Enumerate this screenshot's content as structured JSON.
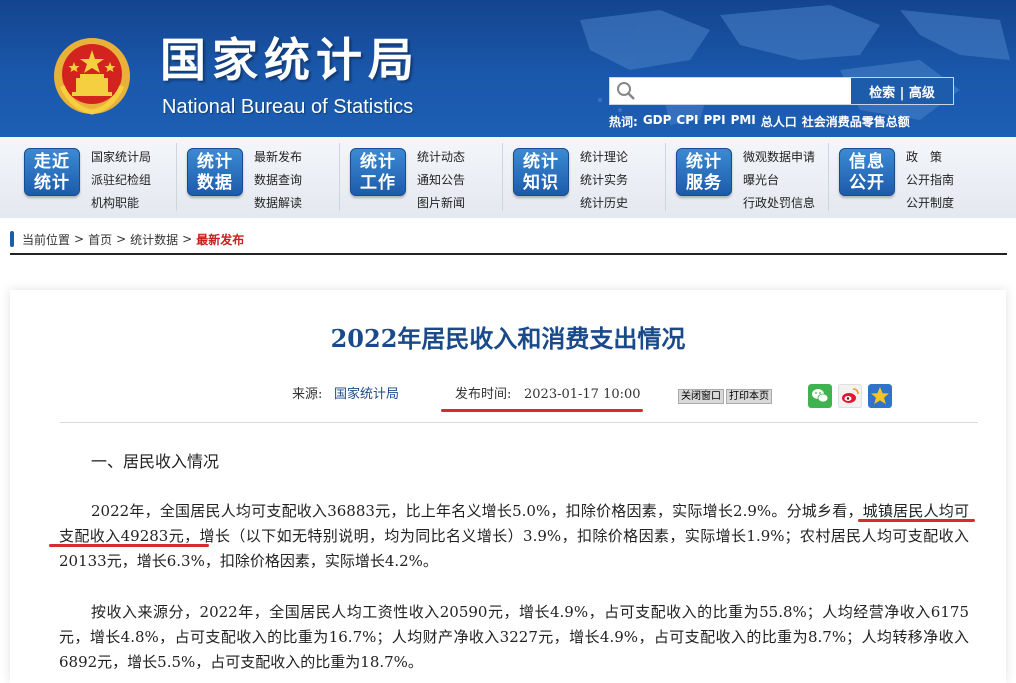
{
  "header": {
    "title_cn": "国家统计局",
    "title_en": "National Bureau of Statistics",
    "search": {
      "placeholder": "",
      "button_label": "检索 | 高级"
    },
    "hot_label": "热词:",
    "hot_words": [
      "GDP",
      "CPI",
      "PPI",
      "PMI",
      "总人口",
      "社会消费品零售总额"
    ]
  },
  "nav": [
    {
      "badge": [
        "走近",
        "统计"
      ],
      "links": [
        "国家统计局",
        "派驻纪检组",
        "机构职能"
      ]
    },
    {
      "badge": [
        "统计",
        "数据"
      ],
      "links": [
        "最新发布",
        "数据查询",
        "数据解读"
      ]
    },
    {
      "badge": [
        "统计",
        "工作"
      ],
      "links": [
        "统计动态",
        "通知公告",
        "图片新闻"
      ]
    },
    {
      "badge": [
        "统计",
        "知识"
      ],
      "links": [
        "统计理论",
        "统计实务",
        "统计历史"
      ]
    },
    {
      "badge": [
        "统计",
        "服务"
      ],
      "links": [
        "微观数据申请",
        "曝光台",
        "行政处罚信息"
      ]
    },
    {
      "badge": [
        "信息",
        "公开"
      ],
      "links": [
        "政　策",
        "公开指南",
        "公开制度"
      ]
    }
  ],
  "breadcrumb": {
    "label": "当前位置",
    "items": [
      "首页",
      "统计数据"
    ],
    "current": "最新发布"
  },
  "article": {
    "title": "2022年居民收入和消费支出情况",
    "source_label": "来源:",
    "source": "国家统计局",
    "time_label": "发布时间:",
    "time": "2023-01-17 10:00",
    "close_btn": "关闭窗口",
    "print_btn": "打印本页",
    "share_icons": [
      "wechat-icon",
      "weibo-icon",
      "favorite-star-icon"
    ],
    "section1": "一、居民收入情况",
    "paragraphs": [
      "2022年，全国居民人均可支配收入36883元，比上年名义增长5.0%，扣除价格因素，实际增长2.9%。分城乡看，城镇居民人均可支配收入49283元，增长（以下如无特别说明，均为同比名义增长）3.9%，扣除价格因素，实际增长1.9%；农村居民人均可支配收入20133元，增长6.3%，扣除价格因素，实际增长4.2%。",
      "按收入来源分，2022年，全国居民人均工资性收入20590元，增长4.9%，占可支配收入的比重为55.8%；人均经营净收入6175元，增长4.8%，占可支配收入的比重为16.7%；人均财产净收入3227元，增长4.9%，占可支配收入的比重为8.7%；人均转移净收入6892元，增长5.5%，占可支配收入的比重为18.7%。"
    ]
  },
  "colors": {
    "header_blue": "#1a58ab",
    "title_blue": "#1a4a8a",
    "highlight_red": "#d92b2b"
  }
}
